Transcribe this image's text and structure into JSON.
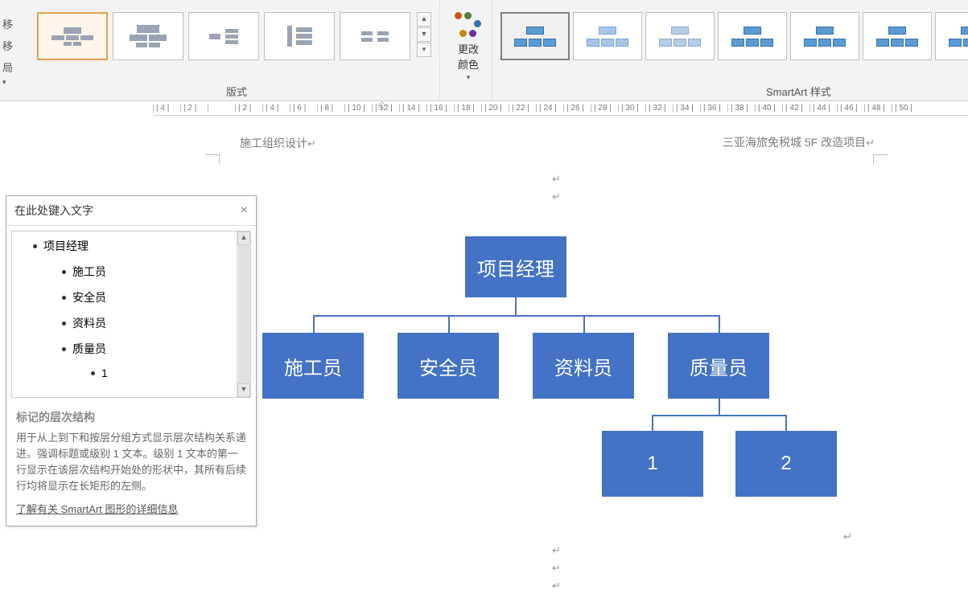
{
  "ribbon": {
    "left_tabs": [
      "移",
      "移",
      "局"
    ],
    "layout_group_label": "版式",
    "change_colors_label": "更改颜色",
    "style_group_label": "SmartArt 样式"
  },
  "ruler": {
    "marks": [
      "4",
      "2",
      "",
      "2",
      "4",
      "6",
      "8",
      "10",
      "12",
      "14",
      "16",
      "18",
      "20",
      "22",
      "24",
      "26",
      "28",
      "30",
      "32",
      "34",
      "36",
      "38",
      "40",
      "42",
      "44",
      "46",
      "48",
      "50"
    ]
  },
  "doc": {
    "header_left": "施工组织设计",
    "header_right": "三亚海旅免税城 5F 改造项目"
  },
  "text_pane": {
    "title": "在此处键入文字",
    "items": [
      {
        "label": "项目经理",
        "indent": 1
      },
      {
        "label": "施工员",
        "indent": 2
      },
      {
        "label": "安全员",
        "indent": 2
      },
      {
        "label": "资料员",
        "indent": 2
      },
      {
        "label": "质量员",
        "indent": 2
      },
      {
        "label": "1",
        "indent": 3
      }
    ],
    "footer_title": "标记的层次结构",
    "footer_desc": "用于从上到下和按层分组方式显示层次结构关系递进。强调标题或级别 1 文本。级别 1 文本的第一行显示在该层次结构开始处的形状中，其所有后续行均将显示在长矩形的左侧。",
    "footer_link": "了解有关 SmartArt 图形的详细信息"
  },
  "chart_data": {
    "type": "hierarchy",
    "title": "",
    "nodes": {
      "root": {
        "label": "项目经理",
        "children": [
          "c1",
          "c2",
          "c3",
          "c4"
        ]
      },
      "c1": {
        "label": "施工员",
        "children": []
      },
      "c2": {
        "label": "安全员",
        "children": []
      },
      "c3": {
        "label": "资料员",
        "children": []
      },
      "c4": {
        "label": "质量员",
        "children": [
          "g1",
          "g2"
        ]
      },
      "g1": {
        "label": "1",
        "children": []
      },
      "g2": {
        "label": "2",
        "children": []
      }
    }
  }
}
